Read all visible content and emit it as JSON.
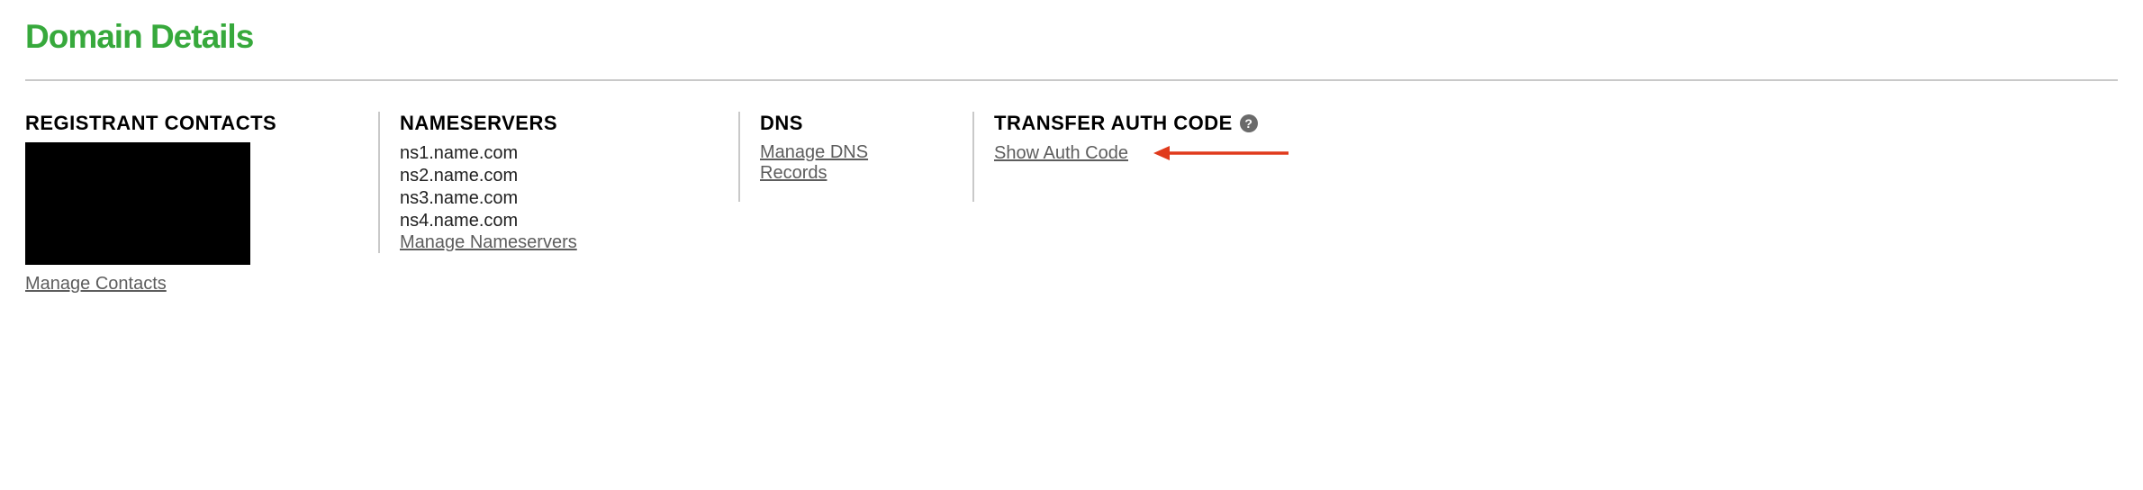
{
  "page_title": "Domain Details",
  "registrant": {
    "label": "REGISTRANT CONTACTS",
    "manage_link": "Manage Contacts"
  },
  "nameservers": {
    "label": "NAMESERVERS",
    "items": [
      "ns1.name.com",
      "ns2.name.com",
      "ns3.name.com",
      "ns4.name.com"
    ],
    "manage_link": "Manage Nameservers"
  },
  "dns": {
    "label": "DNS",
    "manage_link": "Manage DNS Records"
  },
  "auth": {
    "label": "TRANSFER AUTH CODE",
    "show_link": "Show Auth Code",
    "help_glyph": "?"
  }
}
